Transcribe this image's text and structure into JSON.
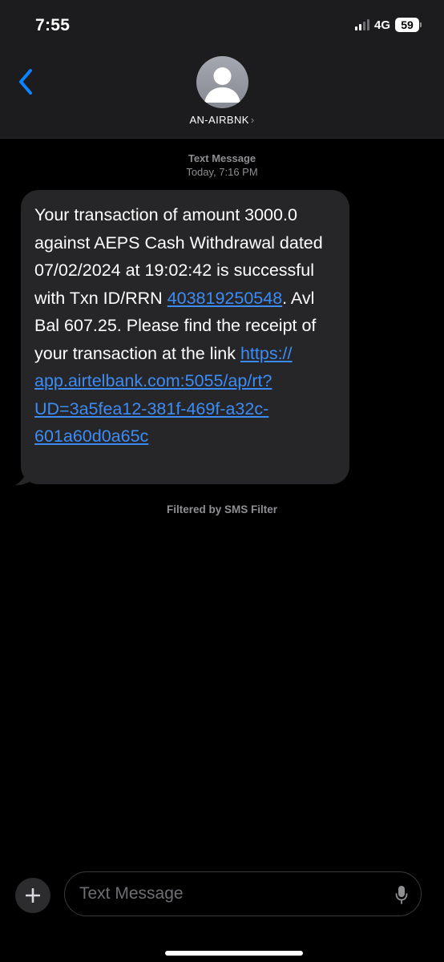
{
  "status_bar": {
    "time": "7:55",
    "network": "4G",
    "battery": "59"
  },
  "header": {
    "contact_name": "AN-AIRBNK",
    "chevron": "›"
  },
  "conversation": {
    "meta_label": "Text Message",
    "meta_time": "Today, 7:16 PM",
    "message": {
      "part1": "Your transaction of amount 3000.0 against AEPS Cash Withdrawal dated 07/02/2024 at 19:02:42 is successful with Txn ID/RRN ",
      "txn_link": "403819250548",
      "part2": ". Avl Bal 607.25. Please find the receipt of your transaction at the link ",
      "receipt_link": "https:// app.airtelbank.com:5055/ap/rt?UD=3a5fea12-381f-469f-a32c-601a60d0a65c"
    },
    "filter_note": "Filtered by SMS Filter"
  },
  "composer": {
    "placeholder": "Text Message"
  },
  "colors": {
    "accent": "#0a84ff",
    "link": "#3d8cf5",
    "bubble": "#262628",
    "header_bg": "#1c1c1e"
  },
  "icons": [
    "back-chevron-icon",
    "contact-silhouette-icon",
    "plus-icon",
    "microphone-icon",
    "signal-icon",
    "battery-icon"
  ]
}
